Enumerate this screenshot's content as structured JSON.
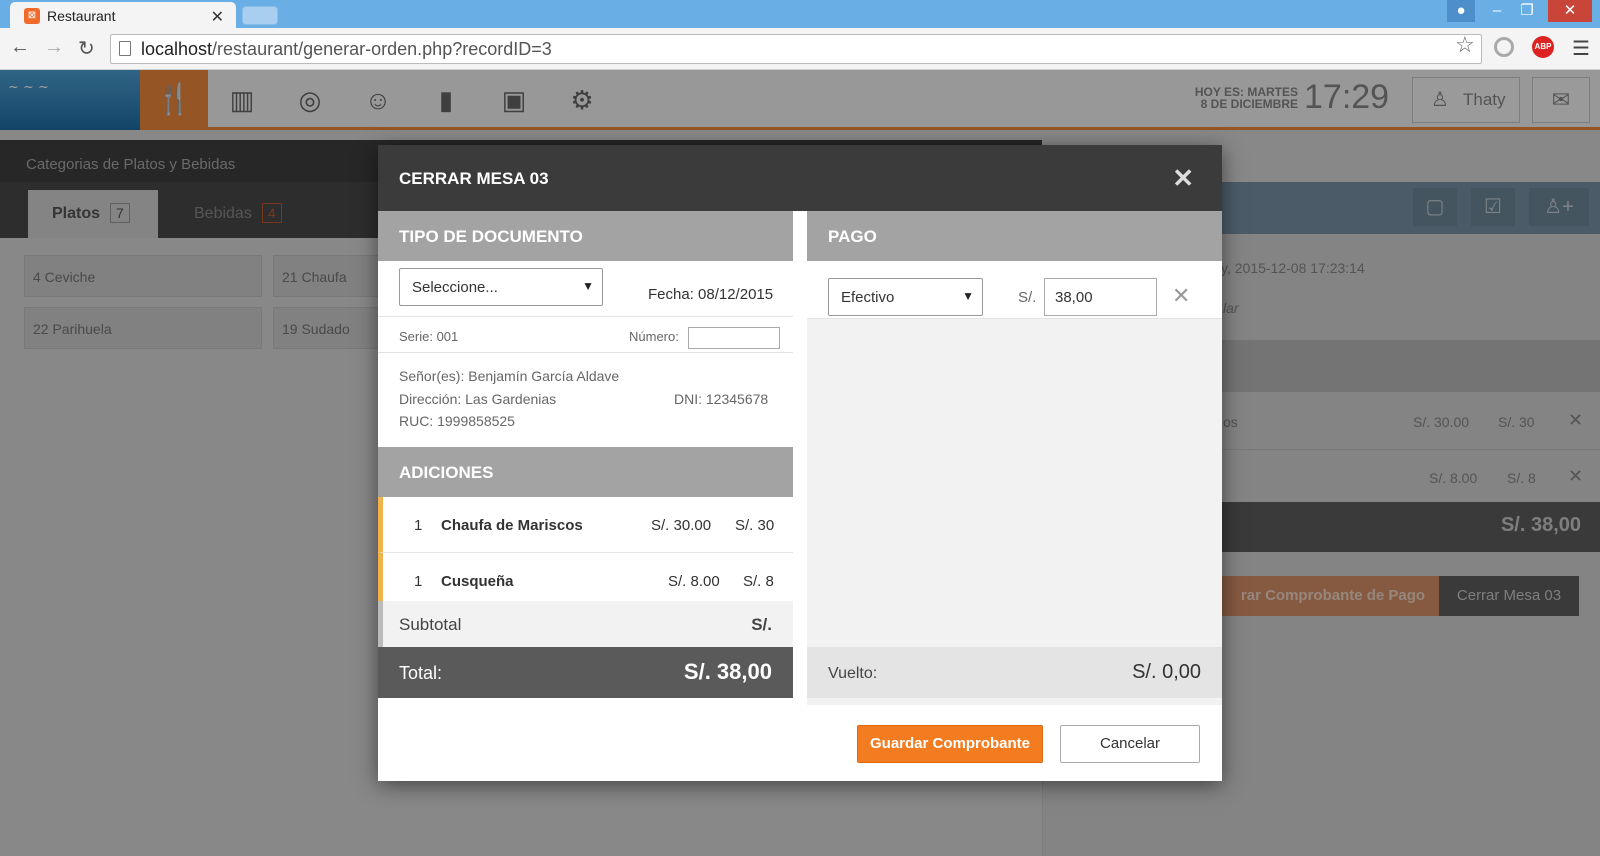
{
  "browser": {
    "tab_title": "Restaurant",
    "url_host": "localhost",
    "url_path": "/restaurant/generar-orden.php?recordID=3"
  },
  "header": {
    "date_line1": "HOY ES: MARTES",
    "date_line2": "8 DE DICIEMBRE",
    "time": "17:29",
    "user": "Thaty"
  },
  "background": {
    "category_title": "Categorias de Platos y Bebidas",
    "tabs": [
      {
        "label": "Platos",
        "count": "7"
      },
      {
        "label": "Bebidas",
        "count": "4"
      }
    ],
    "dishes": [
      "4  Ceviche",
      "21  Chaufa",
      "22  Parihuela",
      "19  Sudado"
    ],
    "order_info": "Thaty, 2015-12-08 17:23:14",
    "order_note": "lar",
    "items": [
      {
        "name": "os",
        "price": "S/. 30.00",
        "total": "S/. 30"
      },
      {
        "name": "",
        "price": "S/. 8.00",
        "total": "S/. 8"
      }
    ],
    "total": "S/. 38,00",
    "btn_comprobante": "rar Comprobante de Pago",
    "btn_cerrar": "Cerrar Mesa 03"
  },
  "modal": {
    "title": "CERRAR MESA 03",
    "doc": {
      "heading": "TIPO DE DOCUMENTO",
      "select_value": "Seleccione...",
      "fecha": "Fecha: 08/12/2015",
      "serie": "Serie: 001",
      "numero_label": "Número:",
      "client_name": "Señor(es): Benjamín García Aldave",
      "client_address": "Dirección: Las Gardenias",
      "client_dni": "DNI: 12345678",
      "client_ruc": "RUC: 1999858525"
    },
    "adiciones": {
      "heading": "ADICIONES",
      "items": [
        {
          "qty": "1",
          "name": "Chaufa de Mariscos",
          "price": "S/. 30.00",
          "total": "S/. 30"
        },
        {
          "qty": "1",
          "name": "Cusqueña",
          "price": "S/. 8.00",
          "total": "S/. 8"
        }
      ],
      "subtotal_label": "Subtotal",
      "subtotal_value": "S/.",
      "total_label": "Total:",
      "total_value": "S/. 38,00"
    },
    "pago": {
      "heading": "PAGO",
      "method": "Efectivo",
      "currency": "S/.",
      "amount": "38,00",
      "vuelto_label": "Vuelto:",
      "vuelto_value": "S/. 0,00"
    },
    "buttons": {
      "save": "Guardar Comprobante",
      "cancel": "Cancelar"
    }
  },
  "colors": {
    "accent": "#f47c20",
    "header_dark": "#3b3b3b",
    "section_gray": "#a3a3a3"
  }
}
